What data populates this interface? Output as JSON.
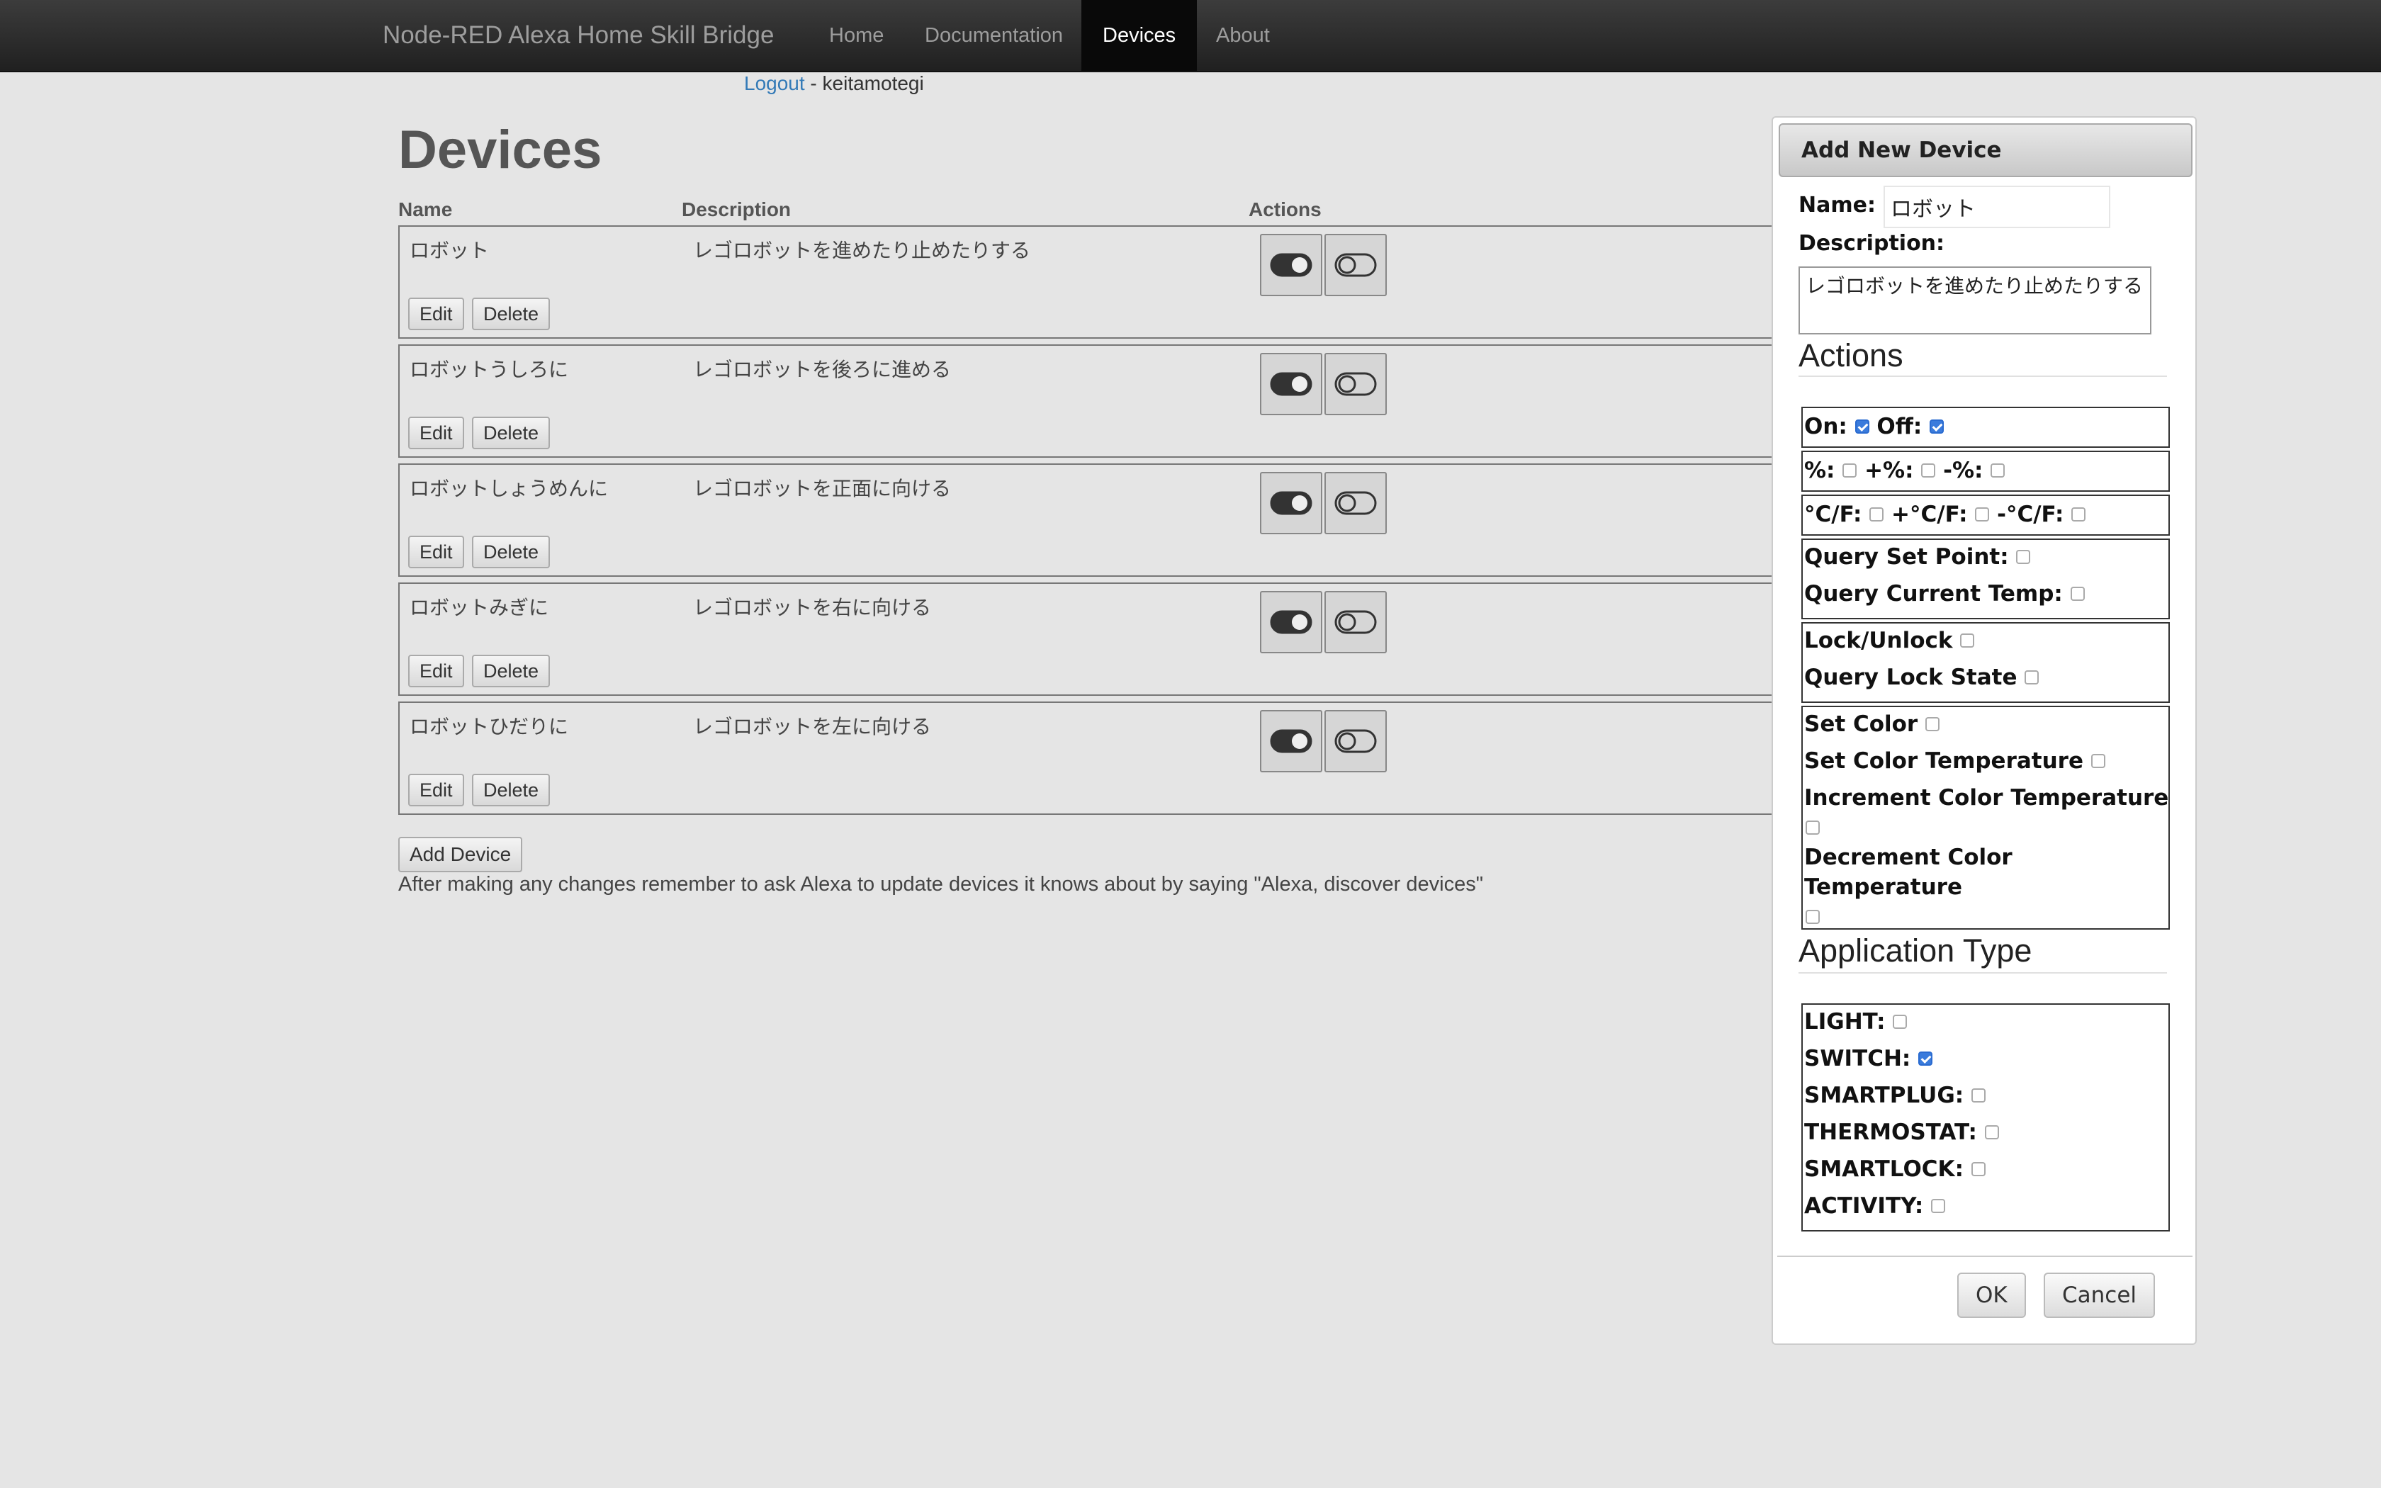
{
  "navbar": {
    "brand": "Node-RED Alexa Home Skill Bridge",
    "links": [
      "Home",
      "Documentation",
      "Devices",
      "About"
    ],
    "active": "Devices"
  },
  "session": {
    "logout_label": "Logout",
    "separator": " - ",
    "username": "keitamotegi"
  },
  "page": {
    "title": "Devices",
    "columns": {
      "name": "Name",
      "description": "Description",
      "actions": "Actions"
    },
    "devices": [
      {
        "name": "ロボット",
        "description": "レゴロボットを進めたり止めたりする"
      },
      {
        "name": "ロボットうしろに",
        "description": "レゴロボットを後ろに進める"
      },
      {
        "name": "ロボットしょうめんに",
        "description": "レゴロボットを正面に向ける"
      },
      {
        "name": "ロボットみぎに",
        "description": "レゴロボットを右に向ける"
      },
      {
        "name": "ロボットひだりに",
        "description": "レゴロボットを左に向ける"
      }
    ],
    "edit_label": "Edit",
    "delete_label": "Delete",
    "add_device_label": "Add Device",
    "hint": "After making any changes remember to ask Alexa to update devices it knows about by saying \"Alexa, discover devices\""
  },
  "dialog": {
    "title": "Add New Device",
    "name_label": "Name:",
    "name_value": "ロボット",
    "description_label": "Description:",
    "description_value": "レゴロボットを進めたり止めたりする",
    "actions_heading": "Actions",
    "actions": {
      "on": "On:",
      "off": "Off:",
      "pct": "%:",
      "plus_pct": "+%:",
      "minus_pct": "-%:",
      "temp": "°C/F:",
      "plus_temp": "+°C/F:",
      "minus_temp": "-°C/F:",
      "query_set_point": "Query Set Point:",
      "query_current_temp": "Query Current Temp:",
      "lock_unlock": "Lock/Unlock",
      "query_lock_state": "Query Lock State",
      "set_color": "Set Color",
      "set_color_temp": "Set Color Temperature",
      "inc_color_temp": "Increment Color Temperature",
      "dec_color_temp_1": "Decrement Color",
      "dec_color_temp_2": "Temperature"
    },
    "app_type_heading": "Application Type",
    "app_types": {
      "light": "LIGHT:",
      "switch": "SWITCH:",
      "smartplug": "SMARTPLUG:",
      "thermostat": "THERMOSTAT:",
      "smartlock": "SMARTLOCK:",
      "activity": "ACTIVITY:"
    },
    "ok_label": "OK",
    "cancel_label": "Cancel",
    "checked": [
      "on",
      "off",
      "switch"
    ],
    "accent_color": "#3a7bdc"
  }
}
